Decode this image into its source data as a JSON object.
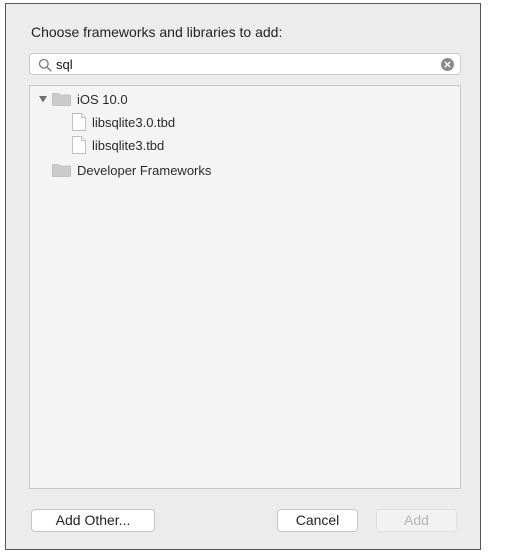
{
  "dialog": {
    "prompt": "Choose frameworks and libraries to add:"
  },
  "search": {
    "value": "sql",
    "search_icon": "magnifier-icon",
    "clear_icon": "clear-circle-icon"
  },
  "tree": {
    "ios_group": {
      "label": "iOS 10.0",
      "expanded": true,
      "items": [
        {
          "label": "libsqlite3.0.tbd",
          "icon": "file-icon"
        },
        {
          "label": "libsqlite3.tbd",
          "icon": "file-icon"
        }
      ]
    },
    "developer_group": {
      "label": "Developer Frameworks",
      "expanded": false
    }
  },
  "buttons": {
    "add_other": "Add Other...",
    "cancel": "Cancel",
    "add": "Add",
    "add_enabled": false
  },
  "colors": {
    "dialog_bg": "#ececec",
    "list_bg": "#f4f4f4",
    "folder": "#c9c9c9",
    "disabled_text": "#b5b5b5"
  }
}
